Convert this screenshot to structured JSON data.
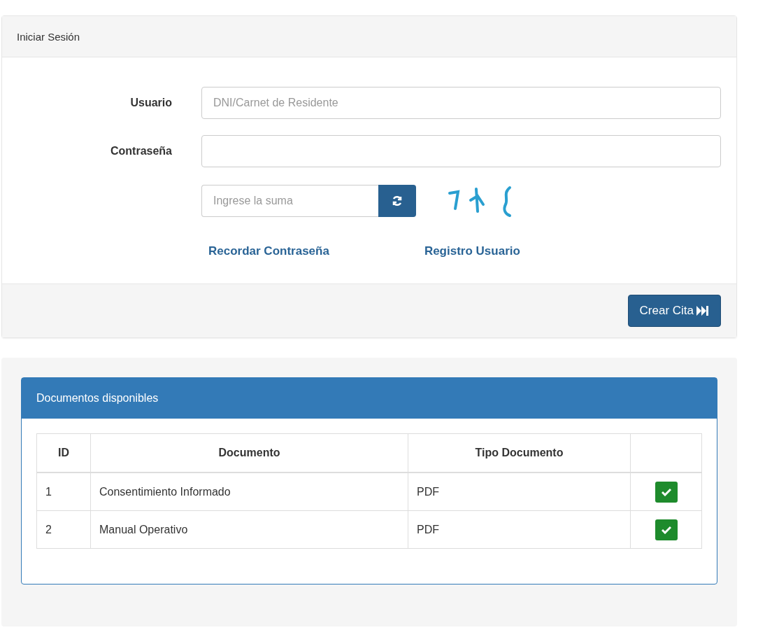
{
  "login_panel": {
    "title": "Iniciar Sesión",
    "fields": [
      {
        "label": "Usuario",
        "placeholder": "DNI/Carnet de Residente"
      },
      {
        "label": "Contraseña"
      }
    ],
    "captcha": {
      "placeholder": "Ingrese la suma"
    },
    "links": [
      "Recordar Contraseña",
      "Registro Usuario"
    ],
    "submit_button": "Crear Cita"
  },
  "documents_panel": {
    "title": "Documentos disponibles",
    "columns": [
      "ID",
      "Documento",
      "Tipo Documento"
    ],
    "rows": [
      {
        "id": "1",
        "document": "Consentimiento Informado",
        "type": "PDF"
      },
      {
        "id": "2",
        "document": "Manual Operativo",
        "type": "PDF"
      }
    ]
  }
}
